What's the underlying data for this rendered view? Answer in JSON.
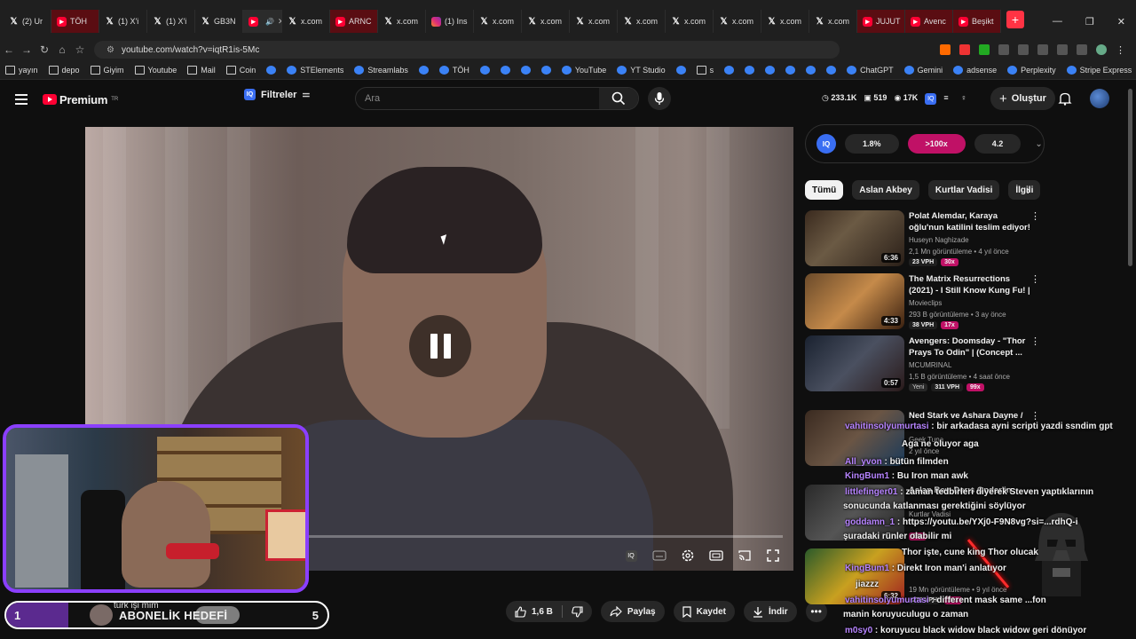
{
  "browser": {
    "tabs": [
      {
        "label": "(2) Ur",
        "icon": "x"
      },
      {
        "label": "TÖH",
        "icon": "red"
      },
      {
        "label": "(1) X'i",
        "icon": "x"
      },
      {
        "label": "(1) X'i",
        "icon": "x"
      },
      {
        "label": "GB3N",
        "icon": "x"
      },
      {
        "label": "",
        "icon": "yt-active"
      },
      {
        "label": "x.com",
        "icon": "x"
      },
      {
        "label": "ARNC",
        "icon": "yt"
      },
      {
        "label": "x.com",
        "icon": "x"
      },
      {
        "label": "(1) Ins",
        "icon": "ig"
      },
      {
        "label": "x.com",
        "icon": "x"
      },
      {
        "label": "x.com",
        "icon": "x"
      },
      {
        "label": "x.com",
        "icon": "x"
      },
      {
        "label": "x.com",
        "icon": "x"
      },
      {
        "label": "x.com",
        "icon": "x"
      },
      {
        "label": "x.com",
        "icon": "x"
      },
      {
        "label": "x.com",
        "icon": "x"
      },
      {
        "label": "x.com",
        "icon": "x"
      },
      {
        "label": "JUJUT",
        "icon": "yt"
      },
      {
        "label": "Avenc",
        "icon": "yt"
      },
      {
        "label": "Beşikt",
        "icon": "yt"
      }
    ],
    "url": "youtube.com/watch?v=iqtR1is-5Mc",
    "bookmarks": [
      {
        "label": "yayın"
      },
      {
        "label": "depo"
      },
      {
        "label": "Giyim"
      },
      {
        "label": "Youtube"
      },
      {
        "label": "Mail"
      },
      {
        "label": "Coin"
      },
      {
        "label": ""
      },
      {
        "label": "STElements"
      },
      {
        "label": "Streamlabs"
      },
      {
        "label": ""
      },
      {
        "label": "TÖH"
      },
      {
        "label": ""
      },
      {
        "label": ""
      },
      {
        "label": ""
      },
      {
        "label": ""
      },
      {
        "label": "YouTube"
      },
      {
        "label": "YT Studio"
      },
      {
        "label": ""
      },
      {
        "label": "s"
      },
      {
        "label": ""
      },
      {
        "label": ""
      },
      {
        "label": ""
      },
      {
        "label": ""
      },
      {
        "label": ""
      },
      {
        "label": ""
      },
      {
        "label": "ChatGPT"
      },
      {
        "label": "Gemini"
      },
      {
        "label": "adsense"
      },
      {
        "label": "Perplexity"
      },
      {
        "label": "Stripe Express"
      }
    ]
  },
  "masthead": {
    "logo": "Premium",
    "logo_region": "TR",
    "filters_label": "Filtreler",
    "search_placeholder": "Ara",
    "stat_views": "233.1K",
    "stat_videos": "519",
    "stat_subs": "17K",
    "create_label": "Oluştur"
  },
  "actions": {
    "likes": "1,6 B",
    "share": "Paylaş",
    "save": "Kaydet",
    "download": "İndir"
  },
  "iq_panel": {
    "logo": "IQ",
    "p1": "1.8%",
    "p2": ">100x",
    "p3": "4.2"
  },
  "chips": [
    "Tümü",
    "Aslan Akbey",
    "Kurtlar Vadisi",
    "İlgili"
  ],
  "recs": [
    {
      "title": "Polat Alemdar, Karaya oğlu'nun katilini teslim ediyor!",
      "channel": "Huseyn Naghizade",
      "meta": "2,1 Mn görüntüleme • 4 yıl önce",
      "duration": "6:36",
      "vph": "23 VPH",
      "mult": "30x"
    },
    {
      "title": "The Matrix Resurrections (2021) - I Still Know Kung Fu! | ...",
      "channel": "Movieclips",
      "meta": "293 B görüntüleme • 3 ay önce",
      "duration": "4:33",
      "vph": "38 VPH",
      "mult": "17x"
    },
    {
      "title": "Avengers: Doomsday - \"Thor Prays To Odin\" | (Concept ...",
      "channel": "MCUMRINAL",
      "meta": "1,5 B görüntüleme • 4 saat önce",
      "duration": "0:57",
      "newtag": "Yeni",
      "vph": "311 VPH",
      "mult": "99x"
    },
    {
      "title": "Ned Stark ve Ashara Dayne /",
      "channel": "Geek Tuna",
      "meta": "2 yıl önce",
      "duration": "",
      "vph": "",
      "mult": ""
    },
    {
      "title": "Aslan Bey, Darıs Onder'in",
      "channel": "Kurtlar Vadisi",
      "meta": "",
      "duration": "",
      "vph": "",
      "mult": "28x"
    },
    {
      "title": "",
      "channel": "",
      "meta": "19 Mn görüntüleme • 9 yıl önce",
      "duration": "6:32",
      "vph": "279 VPH",
      "mult": "21x"
    }
  ],
  "chat": [
    {
      "user": "vahitinsolyumurtasi",
      "text": "bir arkadasa ayni scripti yazdi ssndim gpt"
    },
    {
      "user": "",
      "text": "Aga ne oluyor aga"
    },
    {
      "user": "All_yvon",
      "text": "bütün filmden"
    },
    {
      "user": "KingBum1",
      "text": "Bu Iron man awk"
    },
    {
      "user": "littlefinger01",
      "text": "zaman tedbirleri diyerek Steven yaptıklarının"
    },
    {
      "user": "",
      "text": "sonucunda katlanması gerektiğini söylüyor"
    },
    {
      "user": "goddamn_1",
      "text": "https://youtu.be/YXj0-F9N8vg?si=...rdhQ-i"
    },
    {
      "user": "",
      "text": "şuradaki rünler olabilir mi"
    },
    {
      "user": "",
      "text": "Thor işte, cune king Thor olucak"
    },
    {
      "user": "KingBum1",
      "text": "Direkt Iron man'i anlatıyor"
    },
    {
      "user": "",
      "text": "jiazzz"
    },
    {
      "user": "vahitinsolyumurtasi",
      "text": "different mask same ...fon"
    },
    {
      "user": "",
      "text": "manin koruyuculugu o zaman"
    },
    {
      "user": "m0sy0",
      "text": "koruyucu black widow black widow geri dönüyor"
    }
  ],
  "sub_goal": {
    "current": "1",
    "label": "ABONELİK HEDEFİ",
    "target": "5",
    "user": "türk işi mim"
  },
  "colors": {
    "accent": "#ff0033",
    "iq": "#3a6ef2",
    "hot": "#c01166",
    "cam_border": "#8b3fff",
    "chat_user": "#b784ff"
  }
}
